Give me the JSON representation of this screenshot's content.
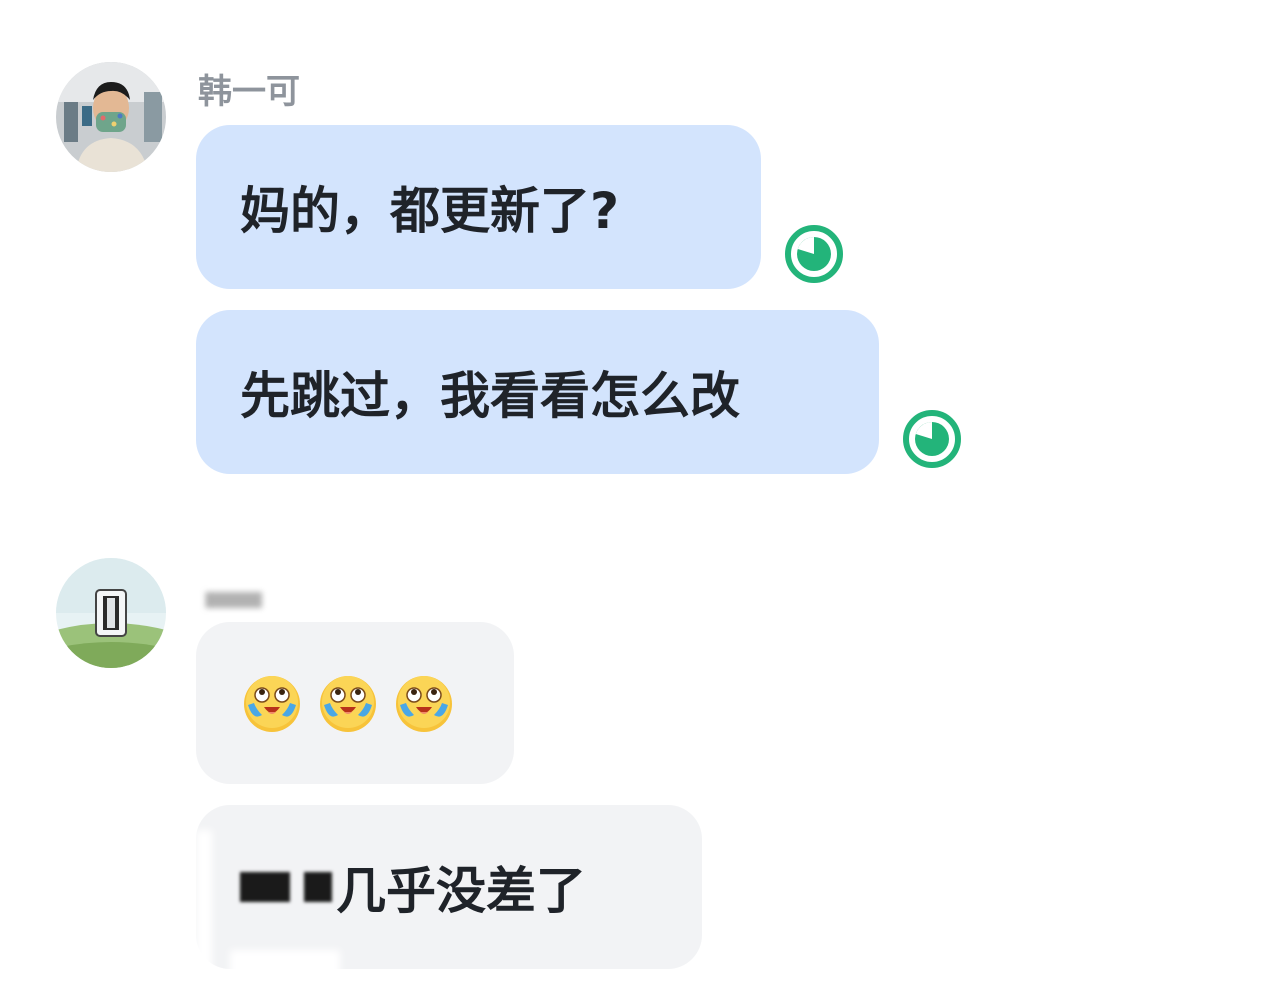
{
  "messages": [
    {
      "sender": "韩一可",
      "avatar": "person-avatar",
      "bubbles": [
        {
          "text": "妈的，都更新了?",
          "status_icon": "read-receipt-icon"
        },
        {
          "text": "先跳过，我看看怎么改",
          "status_icon": "read-receipt-icon"
        }
      ]
    },
    {
      "sender": "",
      "avatar": "landscape-avatar",
      "bubbles": [
        {
          "emojis": [
            "crying-laughing-emoji",
            "crying-laughing-emoji",
            "crying-laughing-emoji"
          ]
        },
        {
          "text": "几乎没差了",
          "redacted_prefix": true
        }
      ]
    }
  ],
  "colors": {
    "my_bubble": "#d3e4fd",
    "their_bubble": "#f2f3f5",
    "read_icon": "#23b47a",
    "sender_name": "#8e949c",
    "message_text": "#1f2329"
  }
}
